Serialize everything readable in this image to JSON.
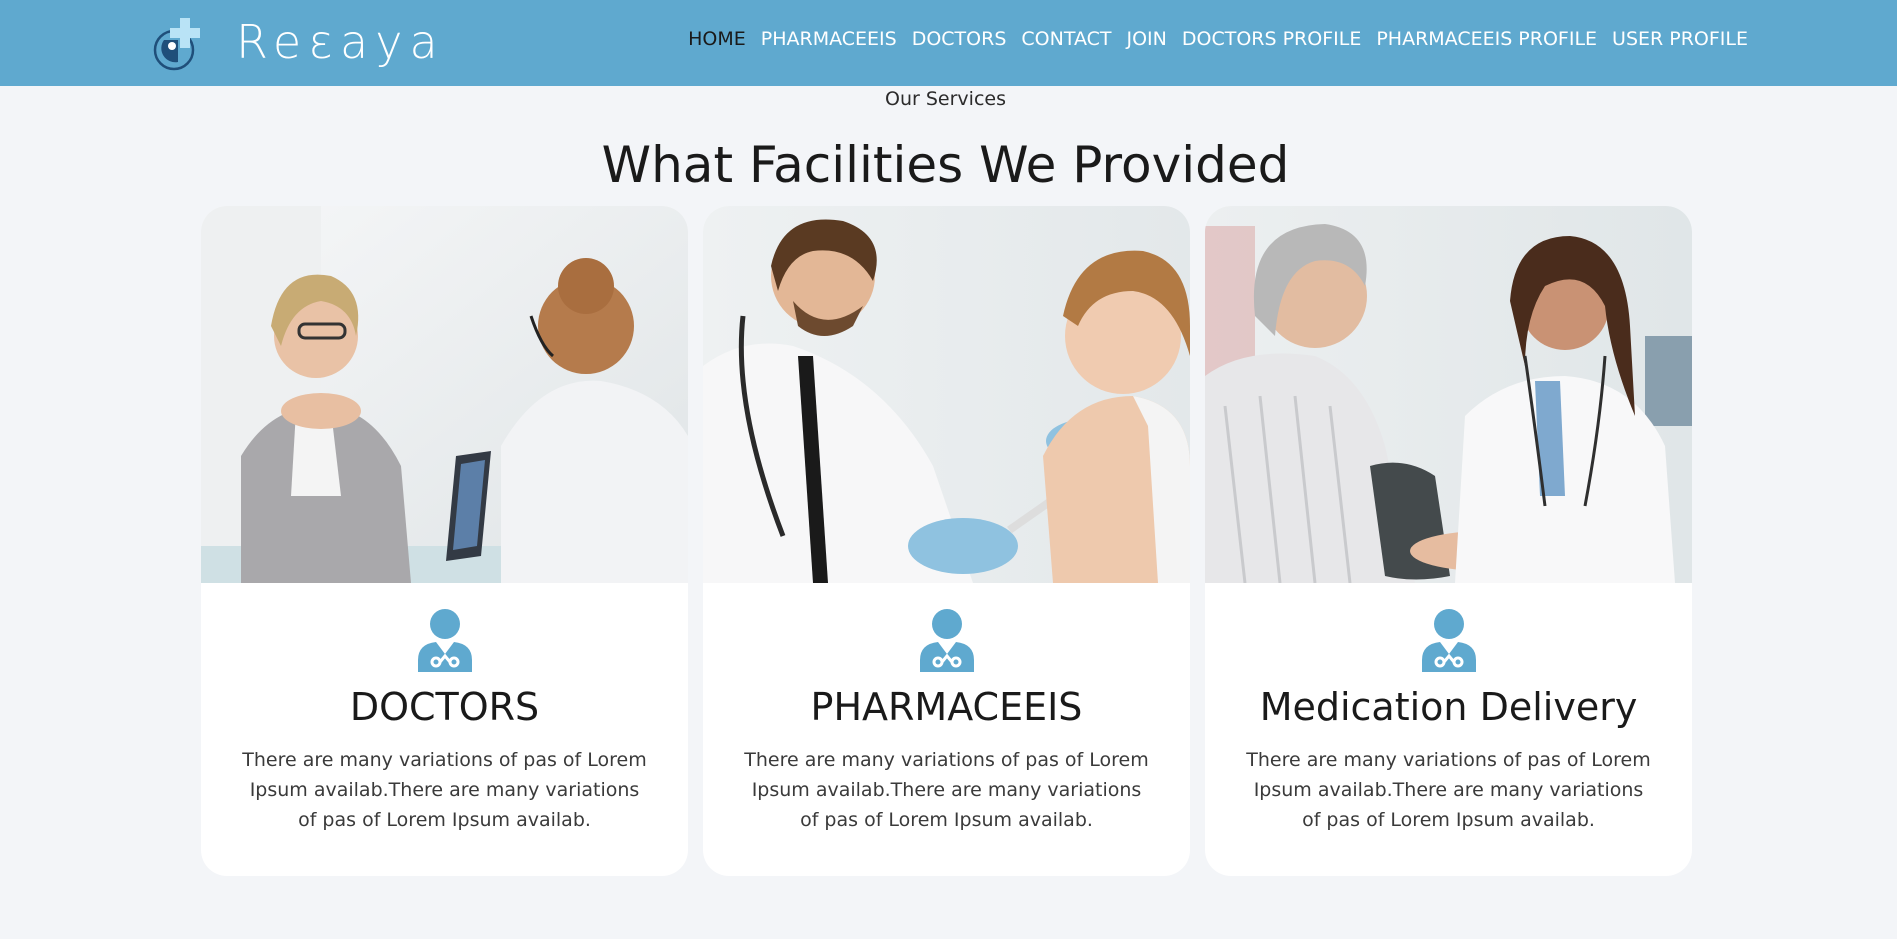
{
  "brand": {
    "name": "Reɛaya",
    "color": "#5fa9cf"
  },
  "nav": {
    "items": [
      {
        "label": "HOME",
        "active": true
      },
      {
        "label": "PHARMACEEIS"
      },
      {
        "label": "DOCTORS"
      },
      {
        "label": "CONTACT"
      },
      {
        "label": "JOIN"
      },
      {
        "label": "DOCTORS PROFILE"
      },
      {
        "label": "PHARMACEEIS PROFILE"
      },
      {
        "label": "USER PROFILE"
      }
    ]
  },
  "services": {
    "subtitle": "Our Services",
    "heading": "What Facilities We Provided",
    "cards": [
      {
        "image": "photo: doctor consulting smiling senior woman at desk with laptop",
        "icon": "doctor-icon",
        "title": "DOCTORS",
        "text": "There are many variations of pas of Lorem Ipsum availab.There are many variations of pas of Lorem Ipsum availab."
      },
      {
        "image": "photo: male doctor giving vaccine injection to a boy",
        "icon": "doctor-icon",
        "title": "PHARMACEEIS",
        "text": "There are many variations of pas of Lorem Ipsum availab.There are many variations of pas of Lorem Ipsum availab."
      },
      {
        "image": "photo: female doctor measuring blood pressure of senior woman",
        "icon": "doctor-icon",
        "title": "Medication Delivery",
        "text": "There are many variations of pas of Lorem Ipsum availab.There are many variations of pas of Lorem Ipsum availab."
      }
    ]
  }
}
